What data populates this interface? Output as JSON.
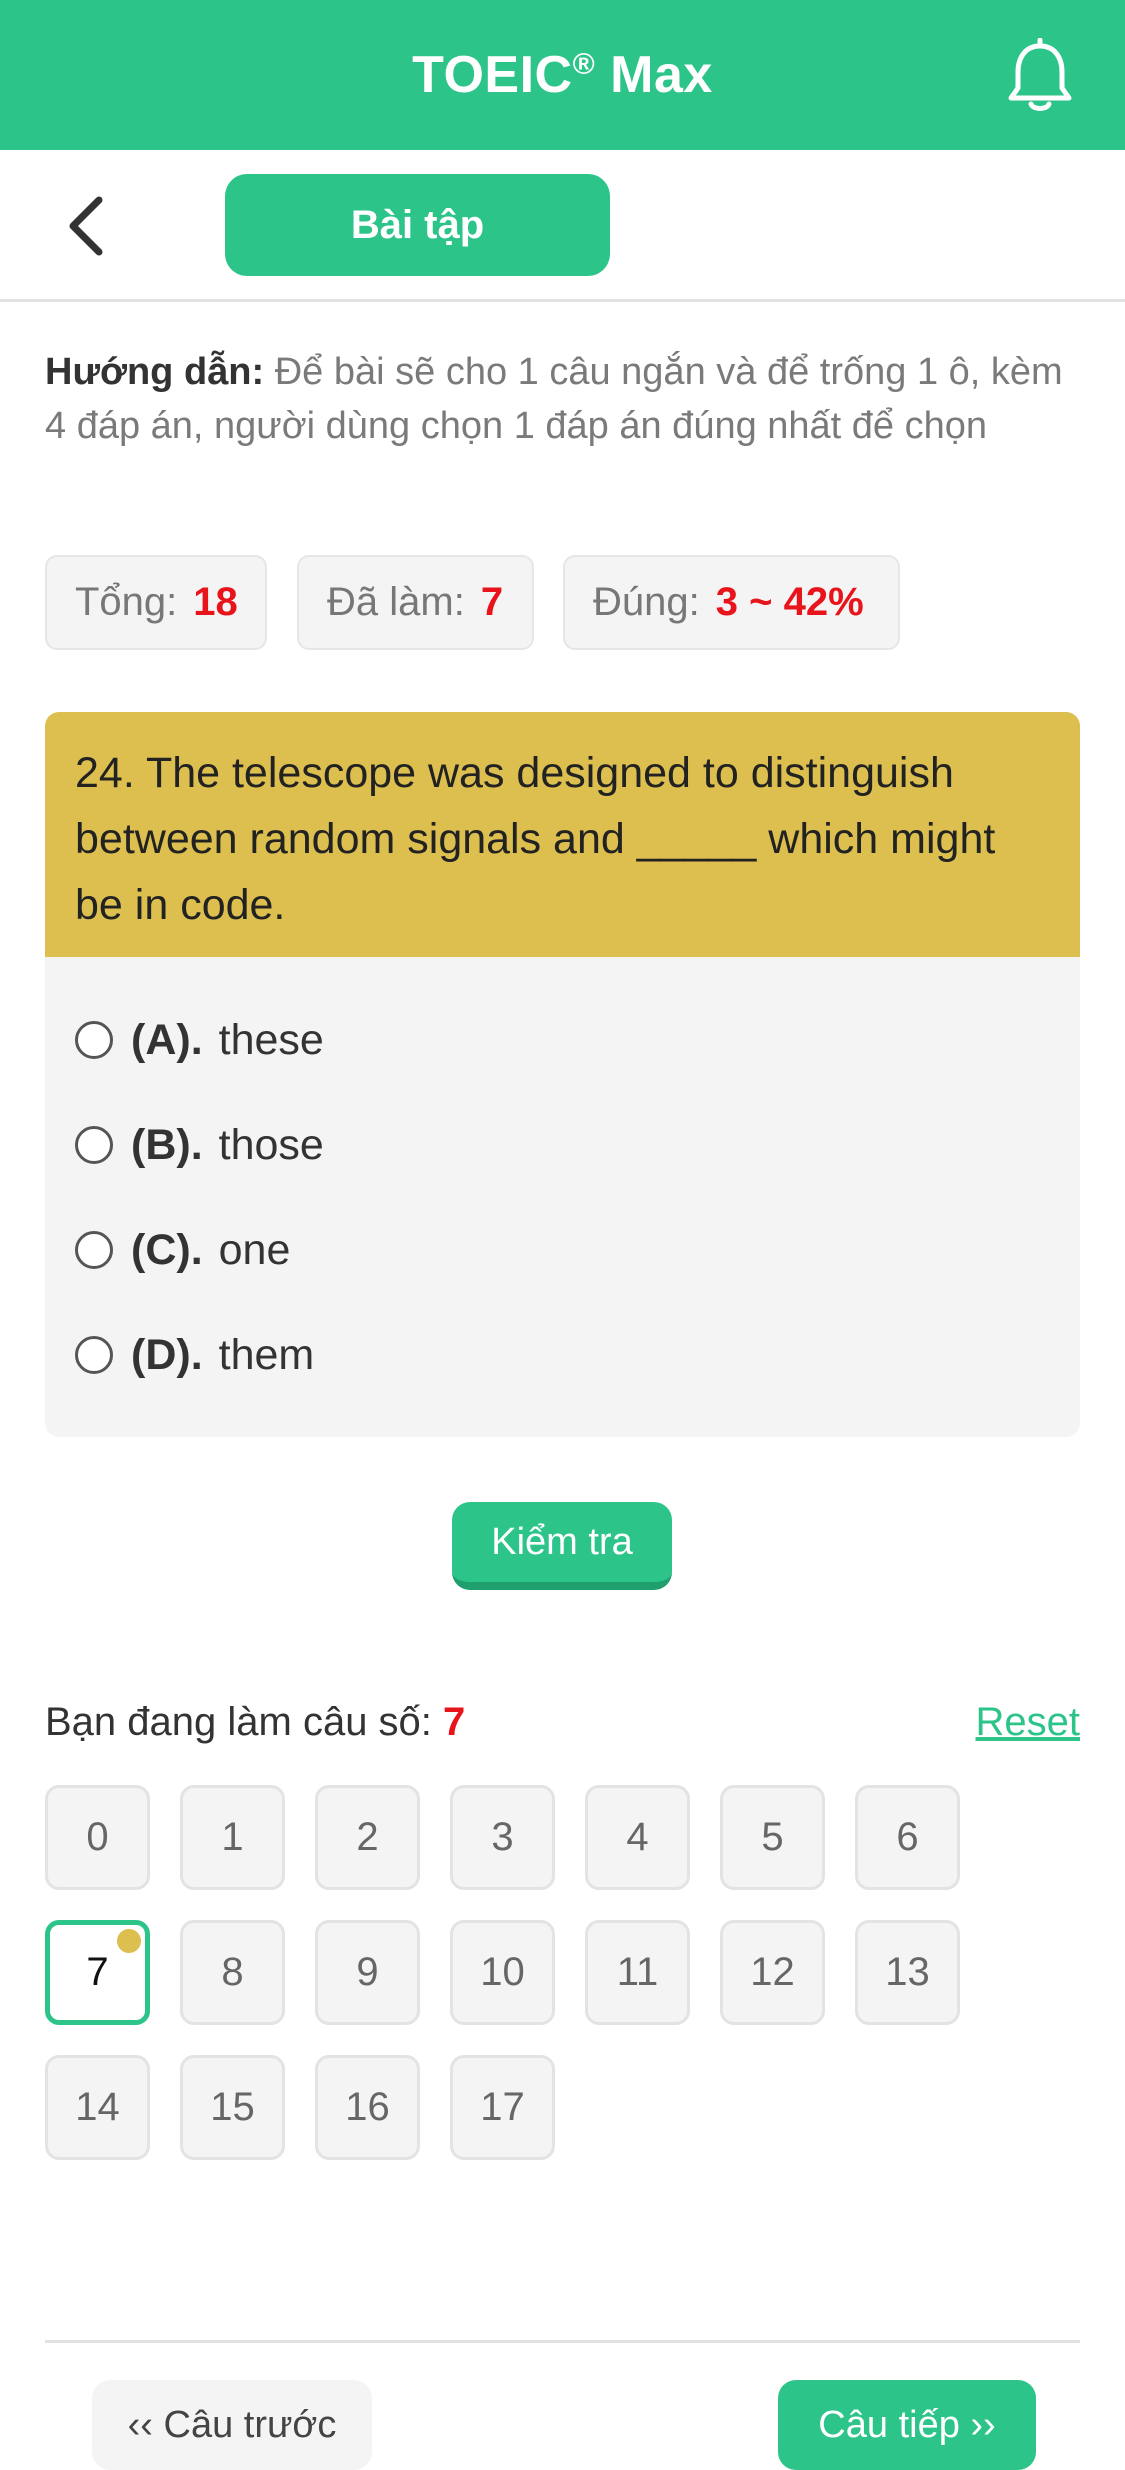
{
  "app": {
    "title": "TOEIC",
    "title_mark": "®",
    "title_suffix": " Max",
    "brand_color": "#2dc48a",
    "notification_icon": "bell-icon"
  },
  "subheader": {
    "back_icon": "chevron-left-icon",
    "tab_label": "Bài tập"
  },
  "instructions": {
    "label": "Hướng dẫn:",
    "text": " Để bài sẽ cho 1 câu ngắn và để trống 1 ô, kèm 4 đáp án, người dùng chọn 1 đáp án đúng nhất để chọn"
  },
  "stats": {
    "total_label": "Tổng:",
    "total_value": "18",
    "done_label": "Đã làm:",
    "done_value": "7",
    "correct_label": "Đúng:",
    "correct_value": "3 ~ 42%"
  },
  "question": {
    "text": "24. The telescope was designed to distinguish between random signals and _____ which might be in code.",
    "options": [
      {
        "letter": "(A).",
        "text": "these"
      },
      {
        "letter": "(B).",
        "text": "those"
      },
      {
        "letter": "(C).",
        "text": "one"
      },
      {
        "letter": "(D).",
        "text": "them"
      }
    ],
    "header_color": "#dcbf4e"
  },
  "check_button": "Kiểm tra",
  "progress": {
    "label": "Bạn đang làm câu số:",
    "current": "7",
    "reset_label": "Reset",
    "numbers": [
      "0",
      "1",
      "2",
      "3",
      "4",
      "5",
      "6",
      "7",
      "8",
      "9",
      "10",
      "11",
      "12",
      "13",
      "14",
      "15",
      "16",
      "17"
    ]
  },
  "nav": {
    "prev_label": "‹‹ Câu trước",
    "next_label": "Câu tiếp ››"
  }
}
